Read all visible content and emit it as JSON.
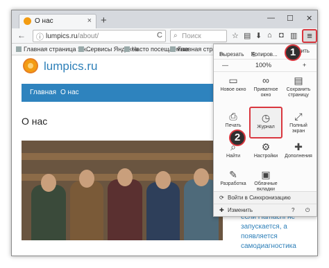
{
  "browser": {
    "tab_title": "О нас",
    "tab_close": "×",
    "new_tab": "+",
    "win_min": "—",
    "win_max": "☐",
    "win_close": "✕"
  },
  "navbar": {
    "url_host": "lumpics.ru",
    "url_path": "/about/",
    "search_placeholder": "Поиск",
    "back": "←",
    "info": "ⓘ",
    "reload": "C",
    "menu": "≡"
  },
  "bookmarks": [
    {
      "label": "Главная страница Ян..."
    },
    {
      "label": "Сервисы Яндекса"
    },
    {
      "label": "Часто посещаемые"
    },
    {
      "label": "Главная страница Ян..."
    }
  ],
  "page": {
    "site_name": "lumpics.ru",
    "nav": [
      "Главная",
      "О нас"
    ],
    "heading": "О нас",
    "sidebar_lines": [
      "если Hamachi не",
      "запускается, а",
      "появляется",
      "самодиагностика"
    ]
  },
  "menu": {
    "cut": "Вырезать",
    "copy": "Копиров...",
    "paste": "Вставить",
    "zoom_minus": "—",
    "zoom_value": "100%",
    "zoom_plus": "+",
    "items": [
      {
        "icon": "▭",
        "label": "Новое окно"
      },
      {
        "icon": "∞",
        "label": "Приватное окно"
      },
      {
        "icon": "▤",
        "label": "Сохранить страницу"
      },
      {
        "icon": "⎙",
        "label": "Печать"
      },
      {
        "icon": "◷",
        "label": "Журнал"
      },
      {
        "icon": "⤢",
        "label": "Полный экран"
      },
      {
        "icon": "⌕",
        "label": "Найти"
      },
      {
        "icon": "⚙",
        "label": "Настройки"
      },
      {
        "icon": "✚",
        "label": "Дополнения"
      },
      {
        "icon": "✎",
        "label": "Разработка"
      },
      {
        "icon": "▣",
        "label": "Облачные вкладки"
      }
    ],
    "sync": "Войти в Синхронизацию",
    "customize": "Изменить",
    "help": "?",
    "quit": "⏻"
  },
  "badges": [
    "1",
    "2"
  ],
  "colors": {
    "accent": "#2e83be",
    "highlight": "#d9363e",
    "logo": "#f39c12"
  }
}
